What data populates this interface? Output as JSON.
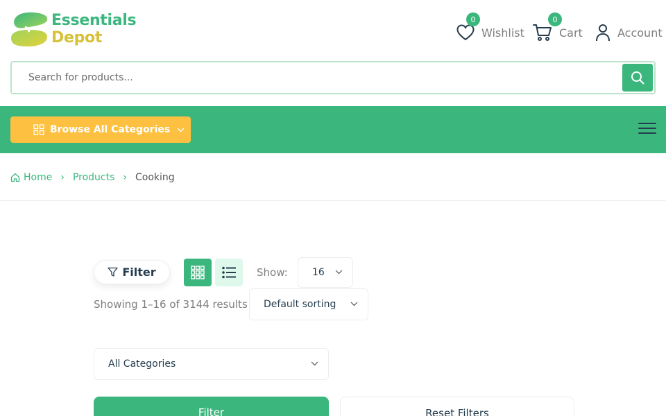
{
  "header": {
    "logo": {
      "line1": "Essentials",
      "line2": "Depot"
    },
    "wishlist": {
      "label": "Wishlist",
      "count": "0",
      "icon": "heart-icon"
    },
    "cart": {
      "label": "Cart",
      "count": "0",
      "icon": "cart-icon"
    },
    "account": {
      "label": "Account",
      "icon": "user-icon"
    }
  },
  "search": {
    "placeholder": "Search for products...",
    "value": "",
    "icon": "search-icon"
  },
  "nav": {
    "browse_label": "Browse All Categories",
    "menu_icon": "hamburger-icon"
  },
  "breadcrumb": {
    "items": [
      {
        "label": "Home",
        "icon": "home-icon"
      },
      {
        "label": "Products"
      },
      {
        "label": "Cooking"
      }
    ]
  },
  "toolbar": {
    "filter_label": "Filter",
    "show_label": "Show:",
    "show_value": "16",
    "results_text": "Showing 1–16 of 3144 results",
    "sort_value": "Default sorting"
  },
  "filters": {
    "category_value": "All Categories",
    "filter_button": "Filter",
    "reset_button": "Reset Filters"
  },
  "colors": {
    "brand_green": "#3bb77e",
    "accent_yellow": "#fdc040",
    "light_green": "#def9ec",
    "border": "#bce3c9"
  }
}
